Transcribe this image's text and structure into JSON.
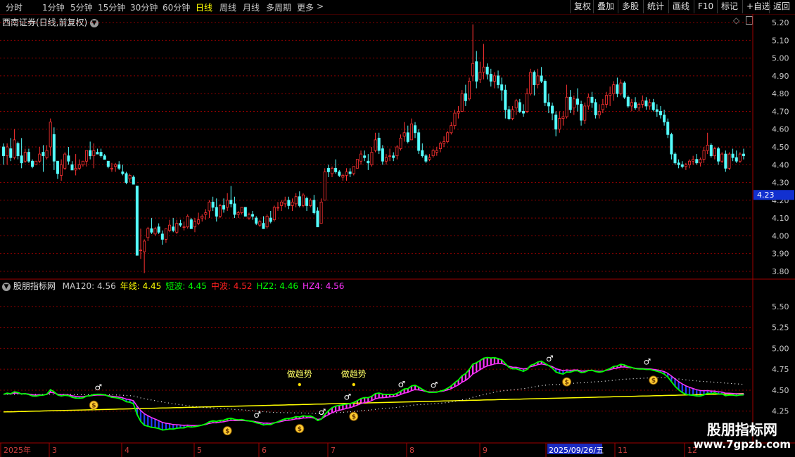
{
  "toolbar": {
    "periods": [
      "分时",
      "1分钟",
      "5分钟",
      "15分钟",
      "30分钟",
      "60分钟",
      "日线",
      "周线",
      "月线",
      "多周期",
      "更多"
    ],
    "active_period": "日线",
    "right_buttons": [
      "复权",
      "叠加",
      "多股",
      "统计",
      "画线",
      "F10",
      "标记",
      "+自选",
      "返回"
    ]
  },
  "main_chart": {
    "title": "西南证券(日线,前复权)",
    "price_axis": [
      "5.20",
      "5.10",
      "5.00",
      "4.90",
      "4.80",
      "4.70",
      "4.60",
      "4.50",
      "4.40",
      "4.30",
      "4.20",
      "4.10",
      "4.00",
      "3.90",
      "3.80"
    ],
    "price_range": [
      3.76,
      5.24
    ],
    "current_price_label": "4.23",
    "current_price": 4.23,
    "up_color": "#ff3232",
    "down_color": "#54ffff",
    "grid_color": "#8b0000",
    "candles": [
      [
        4.5,
        4.52,
        4.4,
        4.45
      ],
      [
        4.45,
        4.52,
        4.4,
        4.5
      ],
      [
        4.49,
        4.55,
        4.42,
        4.44
      ],
      [
        4.44,
        4.6,
        4.43,
        4.54
      ],
      [
        4.52,
        4.53,
        4.43,
        4.45
      ],
      [
        4.45,
        4.55,
        4.38,
        4.41
      ],
      [
        4.42,
        4.49,
        4.41,
        4.47
      ],
      [
        4.47,
        4.49,
        4.41,
        4.42
      ],
      [
        4.42,
        4.43,
        4.38,
        4.39
      ],
      [
        4.4,
        4.42,
        4.4,
        4.42
      ],
      [
        4.42,
        4.5,
        4.41,
        4.46
      ],
      [
        4.47,
        4.51,
        4.36,
        4.45
      ],
      [
        4.44,
        4.51,
        4.43,
        4.48
      ],
      [
        4.5,
        4.66,
        4.45,
        4.64
      ],
      [
        4.57,
        4.61,
        4.37,
        4.42
      ],
      [
        4.42,
        4.42,
        4.32,
        4.35
      ],
      [
        4.34,
        4.43,
        4.31,
        4.4
      ],
      [
        4.38,
        4.47,
        4.37,
        4.46
      ],
      [
        4.45,
        4.5,
        4.4,
        4.42
      ],
      [
        4.4,
        4.42,
        4.37,
        4.37
      ],
      [
        4.37,
        4.46,
        4.34,
        4.38
      ],
      [
        4.38,
        4.43,
        4.37,
        4.4
      ],
      [
        4.4,
        4.42,
        4.39,
        4.42
      ],
      [
        4.42,
        4.48,
        4.39,
        4.48
      ],
      [
        4.48,
        4.53,
        4.43,
        4.45
      ],
      [
        4.45,
        4.52,
        4.38,
        4.48
      ],
      [
        4.47,
        4.49,
        4.46,
        4.46
      ],
      [
        4.47,
        4.49,
        4.44,
        4.45
      ],
      [
        4.45,
        4.46,
        4.43,
        4.43
      ],
      [
        4.42,
        4.42,
        4.38,
        4.39
      ],
      [
        4.38,
        4.41,
        4.36,
        4.38
      ],
      [
        4.39,
        4.41,
        4.36,
        4.4
      ],
      [
        4.4,
        4.42,
        4.37,
        4.38
      ],
      [
        4.36,
        4.4,
        4.34,
        4.35
      ],
      [
        4.35,
        4.36,
        4.29,
        4.3
      ],
      [
        4.32,
        4.35,
        4.3,
        4.34
      ],
      [
        4.33,
        4.34,
        4.29,
        4.29
      ],
      [
        4.28,
        4.28,
        4.06,
        3.89
      ],
      [
        3.92,
        4.04,
        3.87,
        3.92
      ],
      [
        3.91,
        3.98,
        3.79,
        3.97
      ],
      [
        3.99,
        4.05,
        3.97,
        4.04
      ],
      [
        4.04,
        4.1,
        4.01,
        4.02
      ],
      [
        4.01,
        4.05,
        4.0,
        4.04
      ],
      [
        4.05,
        4.07,
        4.01,
        4.02
      ],
      [
        4.01,
        4.03,
        3.95,
        3.98
      ],
      [
        3.98,
        4.04,
        3.96,
        4.04
      ],
      [
        4.03,
        4.09,
        4.02,
        4.06
      ],
      [
        4.05,
        4.1,
        4.02,
        4.03
      ],
      [
        4.02,
        4.09,
        4.01,
        4.07
      ],
      [
        4.07,
        4.09,
        4.05,
        4.06
      ],
      [
        4.05,
        4.08,
        4.03,
        4.05
      ],
      [
        4.05,
        4.12,
        4.04,
        4.11
      ],
      [
        4.09,
        4.1,
        4.04,
        4.04
      ],
      [
        4.05,
        4.1,
        4.02,
        4.08
      ],
      [
        4.07,
        4.13,
        4.06,
        4.09
      ],
      [
        4.1,
        4.12,
        4.08,
        4.11
      ],
      [
        4.12,
        4.15,
        4.09,
        4.13
      ],
      [
        4.14,
        4.2,
        4.1,
        4.19
      ],
      [
        4.19,
        4.22,
        4.14,
        4.16
      ],
      [
        4.16,
        4.21,
        4.08,
        4.11
      ],
      [
        4.11,
        4.18,
        4.1,
        4.17
      ],
      [
        4.17,
        4.21,
        4.13,
        4.15
      ],
      [
        4.16,
        4.24,
        4.14,
        4.2
      ],
      [
        4.2,
        4.28,
        4.16,
        4.18
      ],
      [
        4.18,
        4.22,
        4.1,
        4.12
      ],
      [
        4.12,
        4.14,
        4.1,
        4.13
      ],
      [
        4.13,
        4.16,
        4.12,
        4.16
      ],
      [
        4.16,
        4.16,
        4.11,
        4.11
      ],
      [
        4.1,
        4.13,
        4.09,
        4.12
      ],
      [
        4.12,
        4.14,
        4.09,
        4.11
      ],
      [
        4.1,
        4.11,
        4.06,
        4.07
      ],
      [
        4.06,
        4.09,
        4.05,
        4.08
      ],
      [
        4.07,
        4.11,
        4.04,
        4.04
      ],
      [
        4.05,
        4.12,
        4.04,
        4.11
      ],
      [
        4.1,
        4.14,
        4.07,
        4.08
      ],
      [
        4.09,
        4.17,
        4.08,
        4.16
      ],
      [
        4.16,
        4.19,
        4.14,
        4.16
      ],
      [
        4.17,
        4.2,
        4.14,
        4.19
      ],
      [
        4.18,
        4.22,
        4.16,
        4.2
      ],
      [
        4.2,
        4.22,
        4.15,
        4.17
      ],
      [
        4.17,
        4.21,
        4.14,
        4.19
      ],
      [
        4.18,
        4.24,
        4.16,
        4.22
      ],
      [
        4.22,
        4.25,
        4.16,
        4.17
      ],
      [
        4.17,
        4.24,
        4.16,
        4.23
      ],
      [
        4.21,
        4.22,
        4.14,
        4.17
      ],
      [
        4.17,
        4.21,
        4.16,
        4.2
      ],
      [
        4.2,
        4.23,
        4.12,
        4.13
      ],
      [
        4.14,
        4.16,
        4.05,
        4.05
      ],
      [
        4.07,
        4.21,
        4.07,
        4.19
      ],
      [
        4.2,
        4.38,
        4.2,
        4.36
      ],
      [
        4.38,
        4.4,
        4.33,
        4.36
      ],
      [
        4.35,
        4.39,
        4.33,
        4.38
      ],
      [
        4.38,
        4.43,
        4.35,
        4.36
      ],
      [
        4.36,
        4.37,
        4.33,
        4.34
      ],
      [
        4.33,
        4.35,
        4.31,
        4.34
      ],
      [
        4.34,
        4.38,
        4.31,
        4.36
      ],
      [
        4.36,
        4.38,
        4.33,
        4.35
      ],
      [
        4.35,
        4.39,
        4.34,
        4.39
      ],
      [
        4.38,
        4.43,
        4.38,
        4.43
      ],
      [
        4.42,
        4.48,
        4.4,
        4.46
      ],
      [
        4.45,
        4.48,
        4.42,
        4.44
      ],
      [
        4.42,
        4.46,
        4.37,
        4.41
      ],
      [
        4.4,
        4.5,
        4.39,
        4.47
      ],
      [
        4.48,
        4.58,
        4.47,
        4.54
      ],
      [
        4.55,
        4.58,
        4.46,
        4.48
      ],
      [
        4.49,
        4.51,
        4.4,
        4.42
      ],
      [
        4.42,
        4.46,
        4.4,
        4.44
      ],
      [
        4.45,
        4.49,
        4.42,
        4.45
      ],
      [
        4.45,
        4.47,
        4.42,
        4.44
      ],
      [
        4.45,
        4.51,
        4.43,
        4.5
      ],
      [
        4.49,
        4.57,
        4.48,
        4.55
      ],
      [
        4.56,
        4.64,
        4.53,
        4.58
      ],
      [
        4.58,
        4.62,
        4.52,
        4.53
      ],
      [
        4.54,
        4.66,
        4.54,
        4.63
      ],
      [
        4.62,
        4.64,
        4.55,
        4.58
      ],
      [
        4.58,
        4.6,
        4.46,
        4.48
      ],
      [
        4.48,
        4.52,
        4.44,
        4.45
      ],
      [
        4.45,
        4.46,
        4.41,
        4.42
      ],
      [
        4.43,
        4.46,
        4.42,
        4.44
      ],
      [
        4.45,
        4.49,
        4.44,
        4.48
      ],
      [
        4.47,
        4.5,
        4.45,
        4.48
      ],
      [
        4.49,
        4.53,
        4.47,
        4.52
      ],
      [
        4.52,
        4.56,
        4.5,
        4.53
      ],
      [
        4.53,
        4.59,
        4.52,
        4.58
      ],
      [
        4.58,
        4.64,
        4.57,
        4.62
      ],
      [
        4.62,
        4.71,
        4.6,
        4.69
      ],
      [
        4.69,
        4.73,
        4.66,
        4.7
      ],
      [
        4.7,
        4.82,
        4.7,
        4.8
      ],
      [
        4.8,
        4.85,
        4.73,
        4.76
      ],
      [
        4.77,
        4.89,
        4.76,
        4.87
      ],
      [
        4.9,
        5.19,
        4.87,
        4.97
      ],
      [
        4.98,
        5.04,
        4.83,
        4.87
      ],
      [
        4.88,
        4.98,
        4.86,
        4.92
      ],
      [
        4.92,
        5.08,
        4.88,
        4.95
      ],
      [
        4.95,
        4.97,
        4.88,
        4.91
      ],
      [
        4.91,
        4.94,
        4.84,
        4.87
      ],
      [
        4.87,
        4.92,
        4.83,
        4.9
      ],
      [
        4.9,
        4.93,
        4.83,
        4.85
      ],
      [
        4.85,
        4.89,
        4.76,
        4.82
      ],
      [
        4.82,
        4.85,
        4.66,
        4.71
      ],
      [
        4.71,
        4.73,
        4.65,
        4.66
      ],
      [
        4.66,
        4.73,
        4.65,
        4.71
      ],
      [
        4.72,
        4.77,
        4.68,
        4.76
      ],
      [
        4.75,
        4.77,
        4.69,
        4.7
      ],
      [
        4.7,
        4.74,
        4.67,
        4.69
      ],
      [
        4.7,
        4.83,
        4.69,
        4.8
      ],
      [
        4.8,
        4.94,
        4.79,
        4.92
      ],
      [
        4.92,
        4.93,
        4.79,
        4.85
      ],
      [
        4.85,
        4.94,
        4.83,
        4.9
      ],
      [
        4.9,
        4.95,
        4.86,
        4.87
      ],
      [
        4.87,
        4.88,
        4.73,
        4.75
      ],
      [
        4.75,
        4.8,
        4.69,
        4.73
      ],
      [
        4.73,
        4.75,
        4.65,
        4.69
      ],
      [
        4.68,
        4.7,
        4.56,
        4.6
      ],
      [
        4.6,
        4.7,
        4.58,
        4.66
      ],
      [
        4.66,
        4.7,
        4.62,
        4.67
      ],
      [
        4.67,
        4.85,
        4.66,
        4.78
      ],
      [
        4.78,
        4.82,
        4.69,
        4.71
      ],
      [
        4.72,
        4.79,
        4.68,
        4.77
      ],
      [
        4.77,
        4.83,
        4.7,
        4.74
      ],
      [
        4.74,
        4.76,
        4.62,
        4.65
      ],
      [
        4.65,
        4.75,
        4.63,
        4.73
      ],
      [
        4.73,
        4.8,
        4.71,
        4.78
      ],
      [
        4.78,
        4.81,
        4.72,
        4.75
      ],
      [
        4.75,
        4.77,
        4.66,
        4.68
      ],
      [
        4.68,
        4.74,
        4.66,
        4.7
      ],
      [
        4.71,
        4.77,
        4.69,
        4.74
      ],
      [
        4.74,
        4.81,
        4.72,
        4.79
      ],
      [
        4.79,
        4.84,
        4.73,
        4.8
      ],
      [
        4.8,
        4.87,
        4.76,
        4.85
      ],
      [
        4.85,
        4.89,
        4.78,
        4.8
      ],
      [
        4.8,
        4.88,
        4.79,
        4.86
      ],
      [
        4.86,
        4.87,
        4.77,
        4.78
      ],
      [
        4.78,
        4.79,
        4.72,
        4.73
      ],
      [
        4.73,
        4.77,
        4.7,
        4.75
      ],
      [
        4.75,
        4.78,
        4.71,
        4.72
      ],
      [
        4.72,
        4.75,
        4.7,
        4.74
      ],
      [
        4.74,
        4.79,
        4.72,
        4.76
      ],
      [
        4.76,
        4.78,
        4.71,
        4.73
      ],
      [
        4.73,
        4.77,
        4.71,
        4.75
      ],
      [
        4.75,
        4.77,
        4.7,
        4.71
      ],
      [
        4.71,
        4.74,
        4.67,
        4.7
      ],
      [
        4.7,
        4.73,
        4.66,
        4.68
      ],
      [
        4.68,
        4.71,
        4.62,
        4.64
      ],
      [
        4.64,
        4.66,
        4.55,
        4.57
      ],
      [
        4.57,
        4.58,
        4.43,
        4.46
      ],
      [
        4.46,
        4.47,
        4.4,
        4.41
      ],
      [
        4.41,
        4.43,
        4.38,
        4.4
      ],
      [
        4.4,
        4.42,
        4.38,
        4.39
      ],
      [
        4.39,
        4.41,
        4.37,
        4.4
      ],
      [
        4.4,
        4.43,
        4.38,
        4.42
      ],
      [
        4.42,
        4.45,
        4.4,
        4.43
      ],
      [
        4.43,
        4.46,
        4.4,
        4.41
      ],
      [
        4.41,
        4.44,
        4.39,
        4.43
      ],
      [
        4.43,
        4.5,
        4.41,
        4.48
      ],
      [
        4.48,
        4.58,
        4.46,
        4.51
      ],
      [
        4.51,
        4.52,
        4.44,
        4.45
      ],
      [
        4.45,
        4.5,
        4.43,
        4.49
      ],
      [
        4.49,
        4.5,
        4.4,
        4.42
      ],
      [
        4.42,
        4.47,
        4.41,
        4.46
      ],
      [
        4.46,
        4.48,
        4.36,
        4.38
      ],
      [
        4.38,
        4.47,
        4.37,
        4.46
      ],
      [
        4.46,
        4.49,
        4.42,
        4.44
      ],
      [
        4.44,
        4.48,
        4.41,
        4.42
      ],
      [
        4.42,
        4.47,
        4.41,
        4.46
      ],
      [
        4.46,
        4.49,
        4.43,
        4.45
      ]
    ]
  },
  "indicator": {
    "name": "股朋指标网",
    "legend": [
      {
        "label": "MA120:",
        "value": "4.56",
        "label_color": "#c8c8c8",
        "value_color": "#c8c8c8"
      },
      {
        "label": "年线:",
        "value": "4.45",
        "label_color": "#ffff00",
        "value_color": "#ffff00"
      },
      {
        "label": "短波:",
        "value": "4.45",
        "label_color": "#00ff00",
        "value_color": "#00ff00"
      },
      {
        "label": "中波:",
        "value": "4.52",
        "label_color": "#ff2020",
        "value_color": "#ff2020"
      },
      {
        "label": "HZ2:",
        "value": "4.46",
        "label_color": "#00ff00",
        "value_color": "#00ff00"
      },
      {
        "label": "HZ4:",
        "value": "4.56",
        "label_color": "#ff33ff",
        "value_color": "#ff33ff"
      }
    ],
    "axis_labels": [
      "5.50",
      "5.25",
      "5.00",
      "4.75",
      "4.50",
      "4.25"
    ],
    "range": [
      4.08,
      5.7
    ],
    "annotations": [
      "做趋势",
      "做趋势"
    ],
    "colors": {
      "yearline": "#ffff00",
      "short_wave": "#00ff00",
      "mid_wave": "#ff33ff",
      "blue_band": "#2040ff",
      "dots": "#ffffff",
      "marker": "#ffffff",
      "moneybag": "#ffcc33"
    }
  },
  "time_axis": [
    "2025年",
    "3",
    "4",
    "5",
    "6",
    "7",
    "8",
    "9",
    "2025/09/26/五",
    "11",
    "12"
  ],
  "watermark": {
    "title": "股朋指标网",
    "url": "www.7gpzb.com"
  }
}
